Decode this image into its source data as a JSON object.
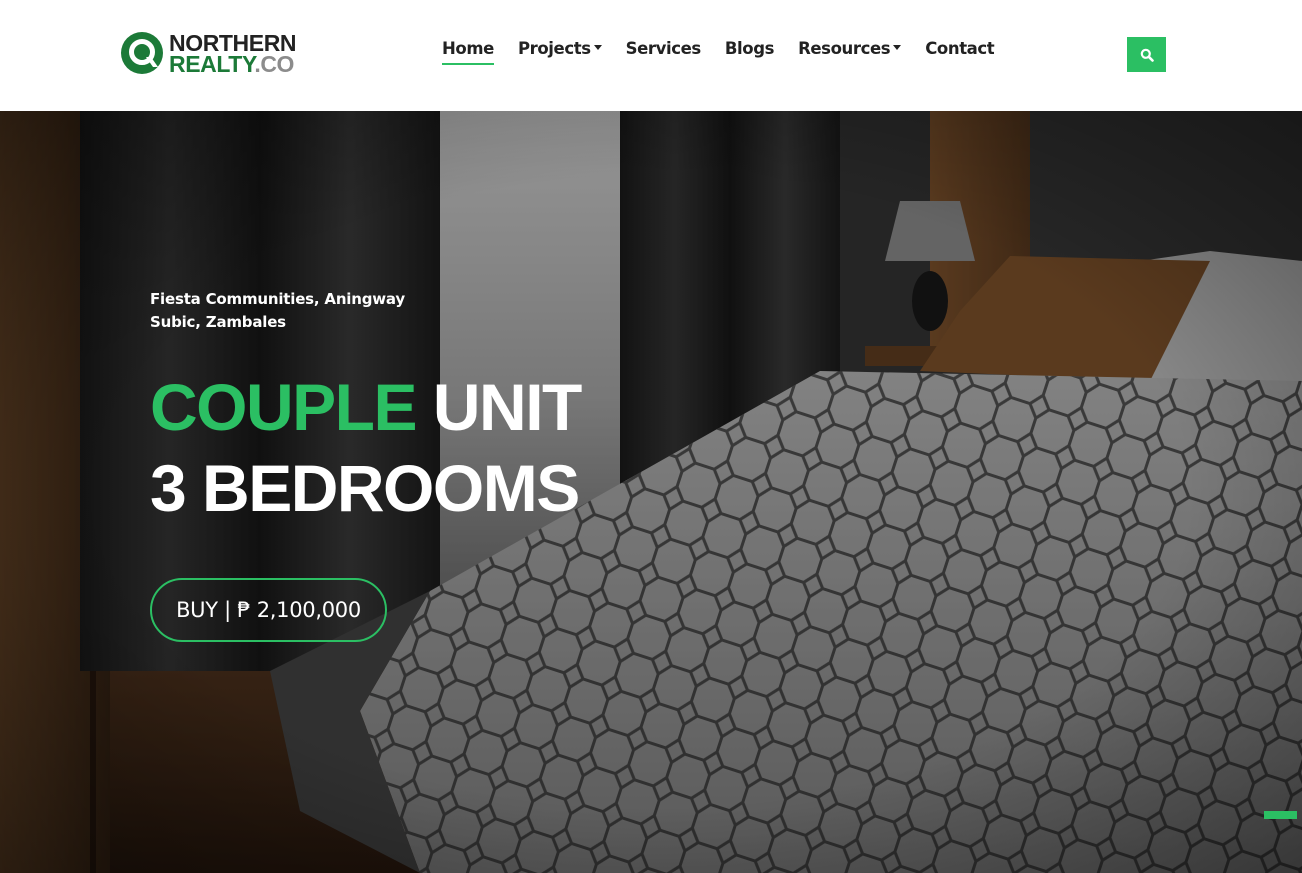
{
  "brand": {
    "line1": "NORTHERN",
    "line2": "REALTY",
    "line2_suffix": ".CO"
  },
  "nav": {
    "items": [
      {
        "label": "Home",
        "active": true,
        "dropdown": false
      },
      {
        "label": "Projects",
        "active": false,
        "dropdown": true
      },
      {
        "label": "Services",
        "active": false,
        "dropdown": false
      },
      {
        "label": "Blogs",
        "active": false,
        "dropdown": false
      },
      {
        "label": "Resources",
        "active": false,
        "dropdown": true
      },
      {
        "label": "Contact",
        "active": false,
        "dropdown": false
      }
    ],
    "search_icon": "search-icon"
  },
  "hero": {
    "location": "Fiesta Communities, Aningway Subic, Zambales",
    "title_accent": "COUPLE",
    "title_rest": " UNIT",
    "title_line2": "3 BEDROOMS",
    "cta": "BUY | ₱ 2,100,000"
  },
  "colors": {
    "accent": "#2bbf63",
    "brand_green": "#1c7a38",
    "nav_text": "#222222"
  }
}
